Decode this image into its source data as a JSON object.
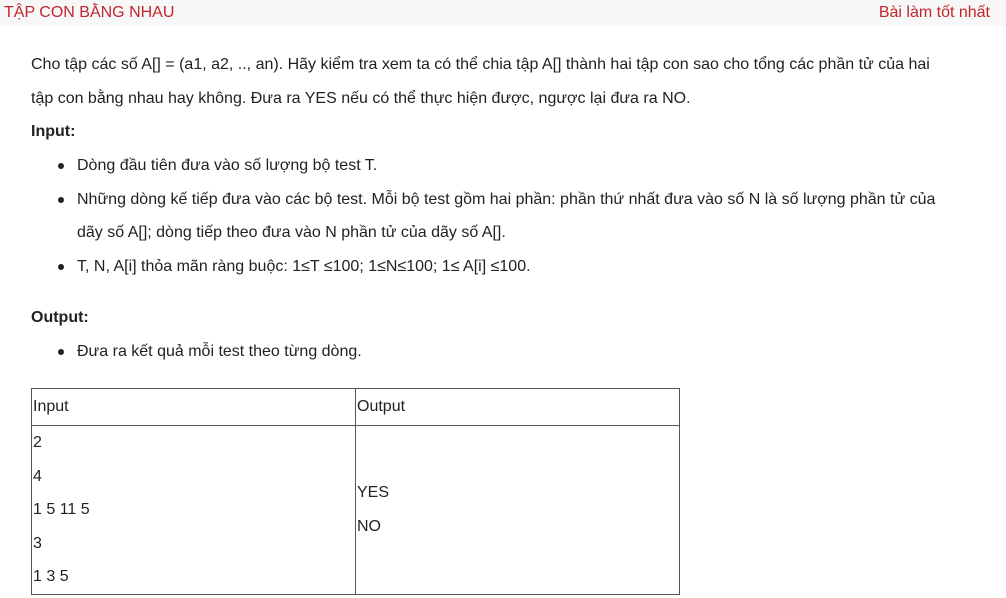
{
  "header": {
    "title": "TẬP CON BẰNG NHAU",
    "best_link": "Bài làm tốt nhất"
  },
  "problem": {
    "statement": [
      "Cho tập các số A[] = (a1, a2, .., an). Hãy kiểm tra xem ta có thể chia tập A[] thành hai tập con sao cho tổng các phần tử của hai",
      "tập con bằng nhau hay không. Đưa ra YES nếu có thể thực hiện được, ngược lại đưa ra NO."
    ],
    "input_heading": "Input:",
    "input_items": [
      "Dòng đầu tiên đưa vào số lượng bộ test T.",
      "Những dòng kế tiếp đưa vào các bộ test. Mỗi bộ test gồm hai phần: phần thứ nhất đưa vào số N là số lượng phần tử của",
      "dãy số A[]; dòng tiếp theo đưa vào N phần tử của dãy số A[].",
      "T, N, A[i] thỏa mãn ràng buộc: 1≤T ≤100; 1≤N≤100; 1≤ A[i] ≤100."
    ],
    "output_heading": "Output:",
    "output_items": [
      "Đưa ra kết quả mỗi test theo từng dòng."
    ]
  },
  "sample": {
    "headers": [
      "Input",
      "Output"
    ],
    "input_lines": [
      "2",
      "4",
      "1 5 11 5",
      "3",
      "1 3 5"
    ],
    "output_lines": [
      "YES",
      "NO"
    ]
  }
}
